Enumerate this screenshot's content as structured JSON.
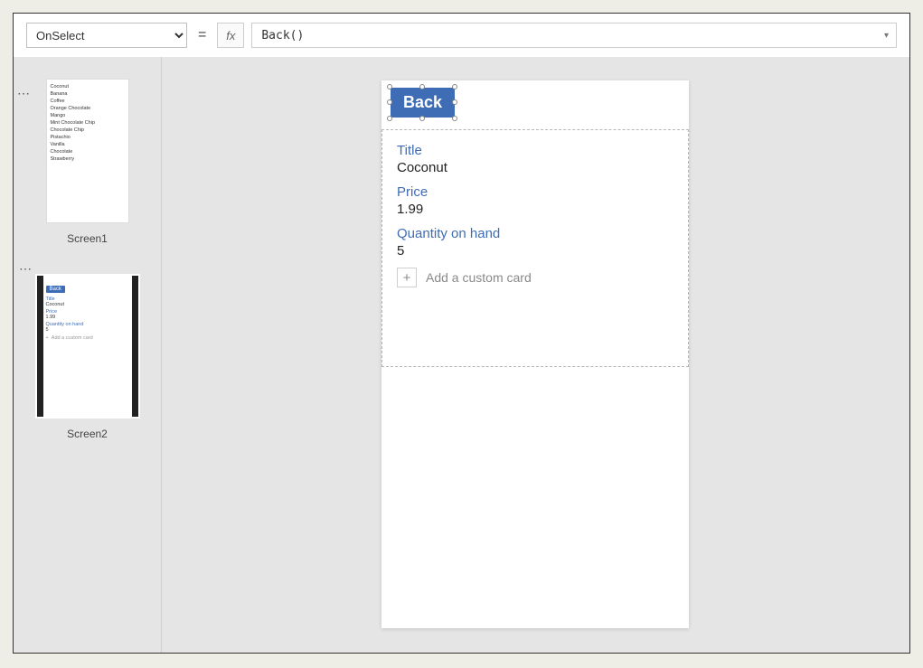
{
  "formula_bar": {
    "property": "OnSelect",
    "equals": "=",
    "fx": "fx",
    "value": "Back()"
  },
  "thumbnails": {
    "screen1": {
      "caption": "Screen1",
      "items": [
        "Coconut",
        "Banana",
        "Coffee",
        "Orange Chocolate",
        "Mango",
        "Mint Chocolate Chip",
        "Chocolate Chip",
        "Pistachio",
        "Vanilla",
        "Chocolate",
        "Strawberry"
      ]
    },
    "screen2": {
      "caption": "Screen2",
      "back": "Back",
      "fields": {
        "title_label": "Title",
        "title_value": "Coconut",
        "price_label": "Price",
        "price_value": "1.99",
        "qty_label": "Quantity on hand",
        "qty_value": "5",
        "add_label": "Add a custom card"
      }
    }
  },
  "canvas": {
    "back_button": "Back",
    "form": {
      "title_label": "Title",
      "title_value": "Coconut",
      "price_label": "Price",
      "price_value": "1.99",
      "qty_label": "Quantity on hand",
      "qty_value": "5",
      "add_card": "Add a custom card",
      "plus": "+"
    }
  }
}
